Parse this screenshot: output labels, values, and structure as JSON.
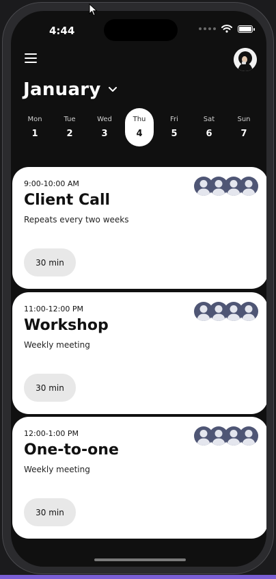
{
  "status_bar": {
    "time": "4:44"
  },
  "header": {
    "month": "January"
  },
  "week": [
    {
      "name": "Mon",
      "date": "1",
      "selected": false
    },
    {
      "name": "Tue",
      "date": "2",
      "selected": false
    },
    {
      "name": "Wed",
      "date": "3",
      "selected": false
    },
    {
      "name": "Thu",
      "date": "4",
      "selected": true
    },
    {
      "name": "Fri",
      "date": "5",
      "selected": false
    },
    {
      "name": "Sat",
      "date": "6",
      "selected": false
    },
    {
      "name": "Sun",
      "date": "7",
      "selected": false
    }
  ],
  "events": [
    {
      "time": "9:00-10:00 AM",
      "title": "Client Call",
      "subtitle": "Repeats every two weeks",
      "duration": "30 min",
      "attendee_count": 4
    },
    {
      "time": "11:00-12:00 PM",
      "title": "Workshop",
      "subtitle": "Weekly meeting",
      "duration": "30 min",
      "attendee_count": 4
    },
    {
      "time": "12:00-1:00 PM",
      "title": "One-to-one",
      "subtitle": "Weekly meeting",
      "duration": "30 min",
      "attendee_count": 4
    }
  ],
  "icons": {
    "menu": "hamburger-menu-icon",
    "avatar": "user-avatar",
    "chevron": "chevron-down-icon",
    "attendee": "person-silhouette-icon"
  },
  "colors": {
    "background": "#101010",
    "card": "#ffffff",
    "attendee_avatar": "#4f5675",
    "duration_chip": "#e8e8e8",
    "accent_strip": "#7b5fd6"
  }
}
